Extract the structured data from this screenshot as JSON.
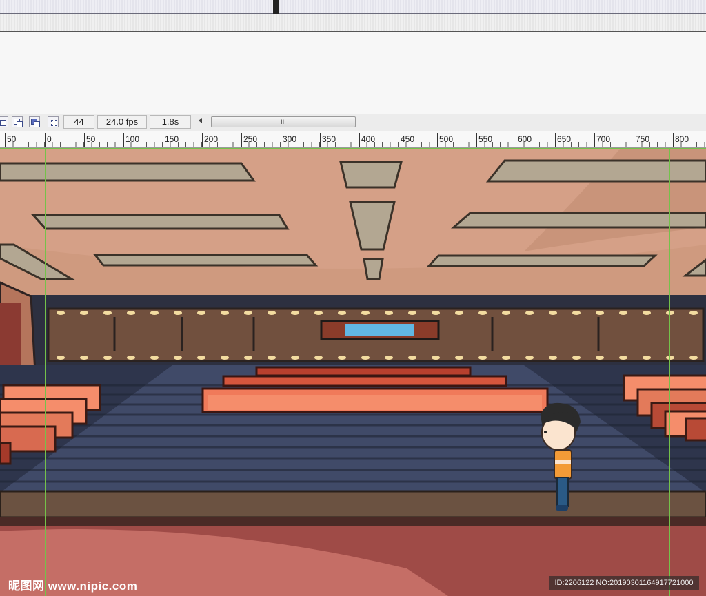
{
  "statusbar": {
    "frame": "44",
    "fps": "24.0 fps",
    "elapsed": "1.8s",
    "scroll_grip": "III"
  },
  "ruler": {
    "labels": [
      "50",
      "0",
      "50",
      "100",
      "150",
      "200",
      "250",
      "300",
      "350",
      "400",
      "450",
      "500",
      "550",
      "600",
      "650",
      "700",
      "750",
      "800"
    ]
  },
  "watermark": {
    "site": "昵图网 www.nipic.com",
    "id": "ID:2206122 NO:20190301164917721000"
  },
  "colors": {
    "ceiling": "#d5a087",
    "stage_floor": "#404a68",
    "wall_dark": "#2d3040",
    "seats": "#f58d6b",
    "floor_front": "#b9605a",
    "guide": "#74c24a",
    "playhead": "#c0282a"
  }
}
